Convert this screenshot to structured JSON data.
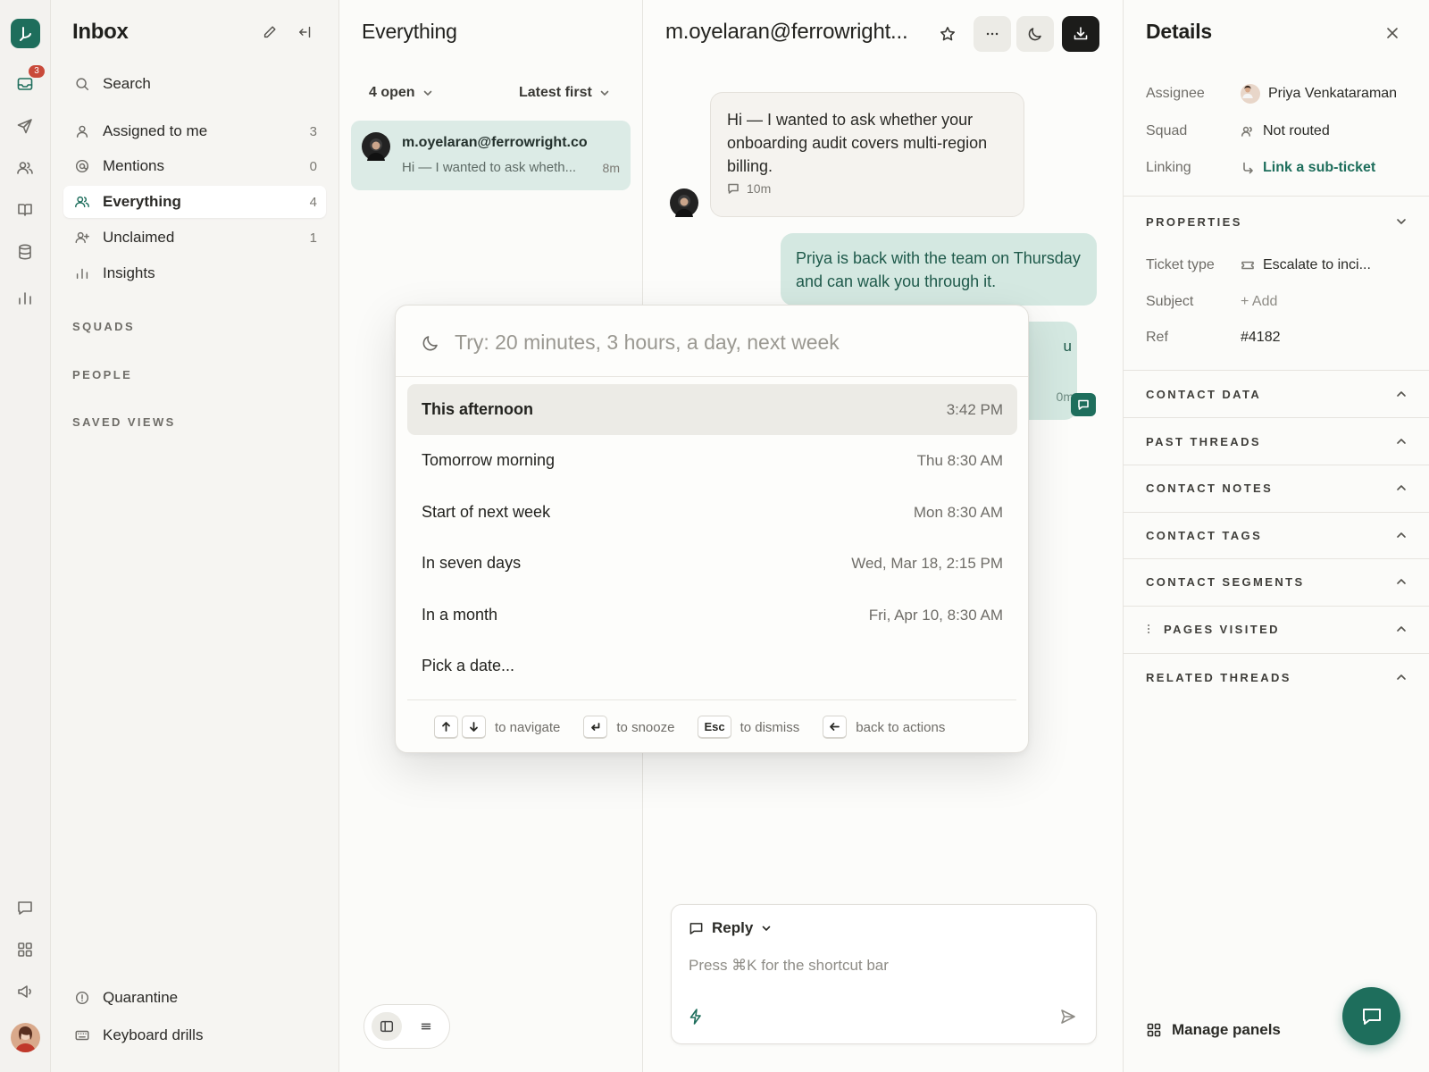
{
  "rail": {
    "inbox_badge": "3",
    "icons": [
      "inbox-icon",
      "send-icon",
      "people-icon",
      "book-icon",
      "database-icon",
      "chart-icon",
      "chat-icon",
      "grid-icon",
      "megaphone-icon"
    ]
  },
  "sidebar": {
    "title": "Inbox",
    "search_label": "Search",
    "items": [
      {
        "label": "Assigned to me",
        "count": "3"
      },
      {
        "label": "Mentions",
        "count": "0"
      },
      {
        "label": "Everything",
        "count": "4"
      },
      {
        "label": "Unclaimed",
        "count": "1"
      },
      {
        "label": "Insights",
        "count": ""
      }
    ],
    "sections": [
      "SQUADS",
      "PEOPLE",
      "SAVED VIEWS"
    ],
    "footer": [
      {
        "label": "Quarantine"
      },
      {
        "label": "Keyboard drills"
      }
    ]
  },
  "list": {
    "title": "Everything",
    "filter_status": "4 open",
    "filter_sort": "Latest first",
    "conversations": [
      {
        "email": "m.oyelaran@ferrowright.co",
        "preview": "Hi — I wanted to ask wheth...",
        "time": "8m"
      }
    ]
  },
  "conversation": {
    "title": "m.oyelaran@ferrowright...",
    "messages": [
      {
        "text": "Hi — I wanted to ask whether your onboarding audit covers multi-region billing.",
        "time": "10m"
      },
      {
        "text": "Priya is back with the team on Thursday and can walk you through it."
      }
    ],
    "partial_bubble": {
      "text": "u",
      "time": "0m"
    },
    "composer": {
      "mode": "Reply",
      "placeholder": "Press ⌘K for the shortcut bar"
    }
  },
  "details": {
    "title": "Details",
    "assignee_label": "Assignee",
    "assignee_value": "Priya Venkataraman",
    "squad_label": "Squad",
    "squad_value": "Not routed",
    "linking_label": "Linking",
    "linking_value": "Link a sub-ticket",
    "properties_title": "PROPERTIES",
    "ticket_type_label": "Ticket type",
    "ticket_type_value": "Escalate to inci...",
    "subject_label": "Subject",
    "subject_value": "+ Add",
    "ref_label": "Ref",
    "ref_value": "#4182",
    "sections": [
      "CONTACT DATA",
      "PAST THREADS",
      "CONTACT NOTES",
      "CONTACT TAGS",
      "CONTACT SEGMENTS",
      "PAGES VISITED",
      "RELATED THREADS"
    ],
    "manage_panels": "Manage panels"
  },
  "snooze": {
    "placeholder": "Try: 20 minutes, 3 hours, a day, next week",
    "options": [
      {
        "label": "This afternoon",
        "time": "3:42 PM"
      },
      {
        "label": "Tomorrow morning",
        "time": "Thu 8:30 AM"
      },
      {
        "label": "Start of next week",
        "time": "Mon 8:30 AM"
      },
      {
        "label": "In seven days",
        "time": "Wed, Mar 18, 2:15 PM"
      },
      {
        "label": "In a month",
        "time": "Fri, Apr 10, 8:30 AM"
      },
      {
        "label": "Pick a date...",
        "time": ""
      }
    ],
    "hints": {
      "navigate": "to navigate",
      "snooze": "to snooze",
      "esc_key": "Esc",
      "dismiss": "to dismiss",
      "back": "back to actions"
    }
  },
  "colors": {
    "accent": "#1e6e5c",
    "badge": "#c94a3a"
  }
}
